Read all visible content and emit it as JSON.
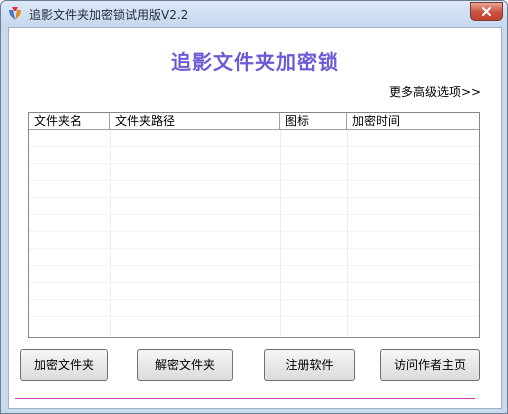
{
  "window": {
    "title": "追影文件夹加密锁试用版V2.2"
  },
  "main": {
    "heading": "追影文件夹加密锁",
    "more_options": "更多高级选项>>"
  },
  "list": {
    "columns": [
      "文件夹名",
      "文件夹路径",
      "图标",
      "加密时间"
    ],
    "rows": []
  },
  "buttons": {
    "encrypt": "加密文件夹",
    "decrypt": "解密文件夹",
    "register": "注册软件",
    "visit_homepage": "访问作者主页"
  },
  "colors": {
    "heading": "#6d5bd5",
    "divider": "#c840b0",
    "close_button": "#c9523d"
  }
}
